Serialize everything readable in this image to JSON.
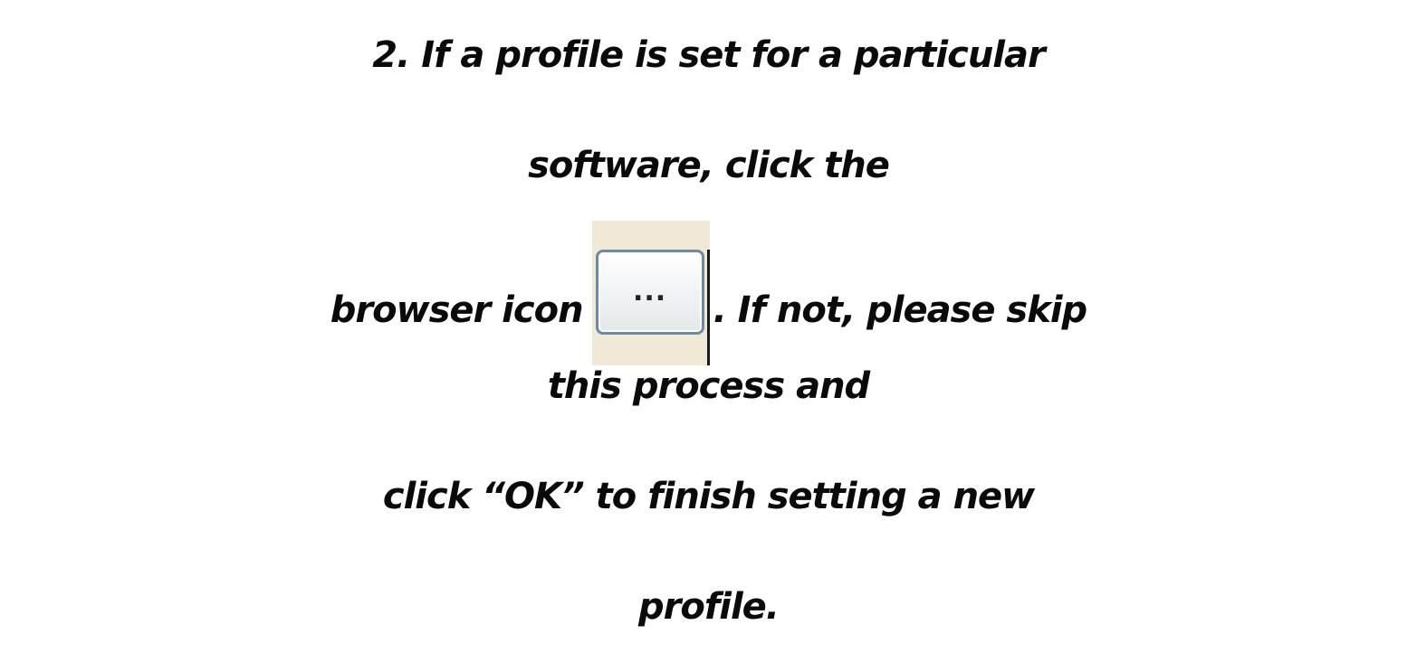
{
  "instruction": {
    "line1": "2. If a profile is set for a particular",
    "line2": "software, click the",
    "line3_before_icon": "browser icon",
    "line3_after_icon": ". If not, please skip",
    "line4": "this process and",
    "line5": "click “OK” to finish setting a new",
    "line6": "profile."
  },
  "browse_button": {
    "label": "...",
    "icon": "ellipsis-browse-icon"
  }
}
